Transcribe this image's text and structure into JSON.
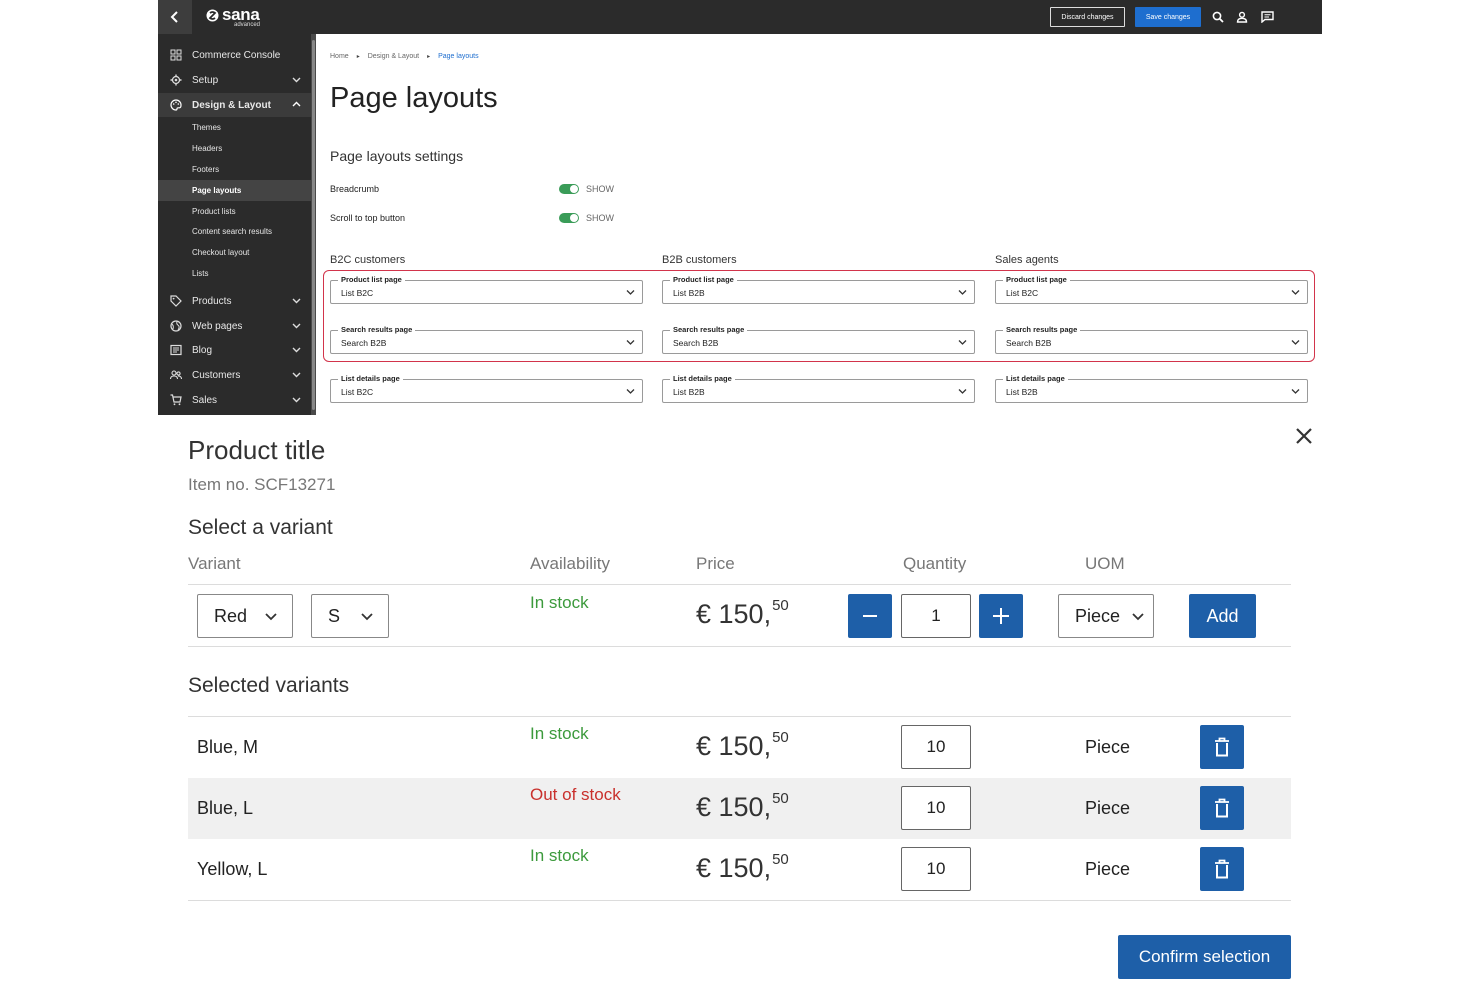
{
  "admin": {
    "logo": "sana",
    "logo_sub": "advanced",
    "discard_label": "Discard changes",
    "save_label": "Save changes",
    "sidebar": {
      "items": [
        {
          "label": "Commerce Console",
          "icon": "grid-icon"
        },
        {
          "label": "Setup",
          "icon": "gear-icon"
        },
        {
          "label": "Design & Layout",
          "icon": "palette-icon"
        },
        {
          "label": "Products",
          "icon": "tag-icon"
        },
        {
          "label": "Web pages",
          "icon": "globe-icon"
        },
        {
          "label": "Blog",
          "icon": "newspaper-icon"
        },
        {
          "label": "Customers",
          "icon": "users-icon"
        },
        {
          "label": "Sales",
          "icon": "cart-icon"
        }
      ],
      "subitems": [
        "Themes",
        "Headers",
        "Footers",
        "Page layouts",
        "Product lists",
        "Content search results",
        "Checkout layout",
        "Lists"
      ]
    },
    "breadcrumb": [
      "Home",
      "Design & Layout",
      "Page layouts"
    ],
    "page_title": "Page layouts",
    "section_title": "Page layouts settings",
    "settings": [
      {
        "label": "Breadcrumb",
        "toggle": "SHOW",
        "on": true
      },
      {
        "label": "Scroll to top button",
        "toggle": "SHOW",
        "on": true
      }
    ],
    "columns": [
      {
        "heading": "B2C customers",
        "fields": [
          {
            "label": "Product list page",
            "value": "List B2C"
          },
          {
            "label": "Search results page",
            "value": "Search B2B"
          },
          {
            "label": "List details page",
            "value": "List B2C"
          }
        ]
      },
      {
        "heading": "B2B customers",
        "fields": [
          {
            "label": "Product list page",
            "value": "List B2B"
          },
          {
            "label": "Search results page",
            "value": "Search B2B"
          },
          {
            "label": "List details page",
            "value": "List B2B"
          }
        ]
      },
      {
        "heading": "Sales agents",
        "fields": [
          {
            "label": "Product list page",
            "value": "List B2C"
          },
          {
            "label": "Search results page",
            "value": "Search B2B"
          },
          {
            "label": "List details page",
            "value": "List B2B"
          }
        ]
      }
    ],
    "colors": {
      "topbar": "#2b2b2b",
      "accent": "#1e6ecf",
      "highlight": "#d2344b",
      "toggle_on": "#3a9c58"
    }
  },
  "dialog": {
    "product_title": "Product title",
    "item_no": "Item no. SCF13271",
    "select_variant": "Select a variant",
    "headers": {
      "variant": "Variant",
      "availability": "Availability",
      "price": "Price",
      "quantity": "Quantity",
      "uom": "UOM"
    },
    "picker": {
      "color": "Red",
      "size": "S",
      "availability": "In stock",
      "price_main": "€ 150,",
      "price_cents": "50",
      "quantity": "1",
      "uom": "Piece",
      "add_label": "Add"
    },
    "selected_title": "Selected variants",
    "selected": [
      {
        "name": "Blue, M",
        "availability": "In stock",
        "status": "in",
        "price_main": "€ 150,",
        "price_cents": "50",
        "quantity": "10",
        "uom": "Piece"
      },
      {
        "name": "Blue, L",
        "availability": "Out of stock",
        "status": "out",
        "price_main": "€ 150,",
        "price_cents": "50",
        "quantity": "10",
        "uom": "Piece"
      },
      {
        "name": "Yellow, L",
        "availability": "In stock",
        "status": "in",
        "price_main": "€ 150,",
        "price_cents": "50",
        "quantity": "10",
        "uom": "Piece"
      }
    ],
    "confirm_label": "Confirm selection",
    "colors": {
      "button": "#1e5fa8",
      "in_stock": "#3c9a3c",
      "out_of_stock": "#c9302c"
    }
  }
}
